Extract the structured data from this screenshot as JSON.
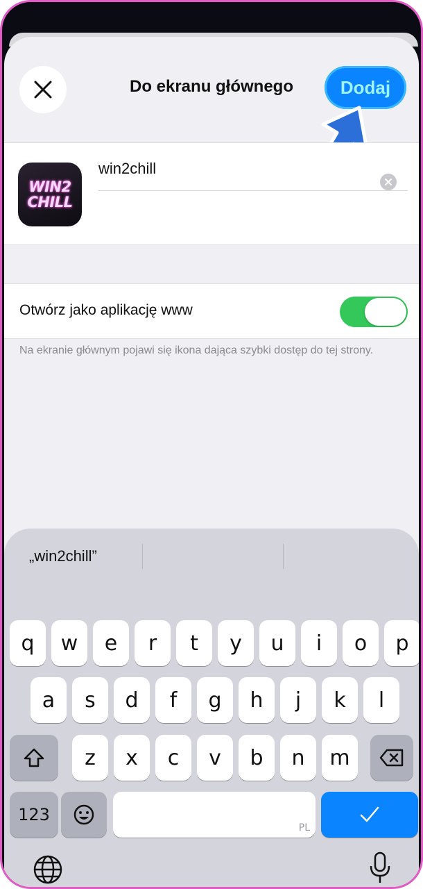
{
  "header": {
    "title": "Do ekranu głównego",
    "add_label": "Dodaj"
  },
  "app": {
    "icon_line1": "WIN2",
    "icon_line2": "CHILL",
    "name_value": "win2chill"
  },
  "webapp": {
    "label": "Otwórz jako aplikację www",
    "toggle_on": true
  },
  "hint": "Na ekranie głównym pojawi się ikona dająca szybki dostęp do tej strony.",
  "keyboard": {
    "suggestion": "„win2chill”",
    "row1": [
      "q",
      "w",
      "e",
      "r",
      "t",
      "y",
      "u",
      "i",
      "o",
      "p"
    ],
    "row2": [
      "a",
      "s",
      "d",
      "f",
      "g",
      "h",
      "j",
      "k",
      "l"
    ],
    "row3": [
      "z",
      "x",
      "c",
      "v",
      "b",
      "n",
      "m"
    ],
    "numbers_label": "123",
    "space_lang": "PL"
  },
  "colors": {
    "accent": "#0a84ff",
    "toggle": "#34c759",
    "frame": "#e05bc4"
  }
}
